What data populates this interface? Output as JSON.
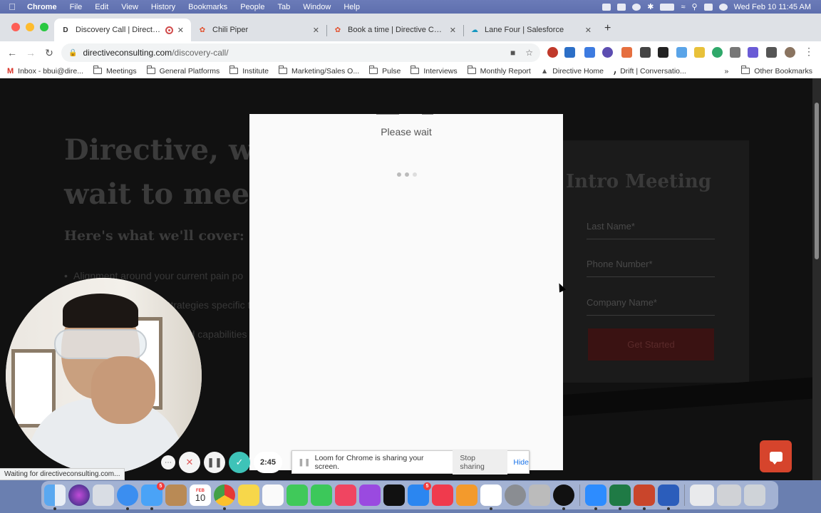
{
  "menubar": {
    "app_name": "Chrome",
    "items": [
      "File",
      "Edit",
      "View",
      "History",
      "Bookmarks",
      "People",
      "Tab",
      "Window",
      "Help"
    ],
    "clock": "Wed Feb 10  11:45 AM"
  },
  "tabs": [
    {
      "title": "Discovery Call | Directive",
      "active": true
    },
    {
      "title": "Chili Piper",
      "active": false
    },
    {
      "title": "Book a time | Directive Consulting",
      "active": false
    },
    {
      "title": "Lane Four | Salesforce",
      "active": false
    }
  ],
  "address_bar": {
    "domain": "directiveconsulting.com",
    "path": "/discovery-call/"
  },
  "bookmarks": [
    {
      "label": "Inbox - bbui@dire...",
      "type": "gmail"
    },
    {
      "label": "Meetings",
      "type": "folder"
    },
    {
      "label": "General Platforms",
      "type": "folder"
    },
    {
      "label": "Institute",
      "type": "folder"
    },
    {
      "label": "Marketing/Sales O...",
      "type": "folder"
    },
    {
      "label": "Pulse",
      "type": "folder"
    },
    {
      "label": "Interviews",
      "type": "folder"
    },
    {
      "label": "Monthly Report",
      "type": "folder"
    },
    {
      "label": "Directive Home",
      "type": "link"
    },
    {
      "label": "Drift | Conversatio...",
      "type": "link"
    }
  ],
  "bookmarks_overflow": "»",
  "other_bookmarks": "Other Bookmarks",
  "page": {
    "hero_line1": "Directive, we",
    "hero_line2": "wait to meet",
    "cover_heading": "Here's what we'll cover:",
    "bullets": [
      "Alignment around your current pain po",
      "Strategies specific to your",
      "and capabilities"
    ],
    "form_title": "Intro Meeting",
    "fields": [
      "Last Name*",
      "Phone Number*",
      "Company Name*"
    ],
    "submit_label": "Get Started"
  },
  "modal": {
    "message": "Please wait"
  },
  "loom": {
    "timer": "2:45",
    "sharing_text": "Loom for Chrome is sharing your screen.",
    "stop_label": "Stop sharing",
    "hide_label": "Hide"
  },
  "status_text": "Waiting for directiveconsulting.com...",
  "dock": {
    "calendar_month": "FEB",
    "calendar_day": "10",
    "mail_badge": "5",
    "appstore_badge": "5"
  }
}
